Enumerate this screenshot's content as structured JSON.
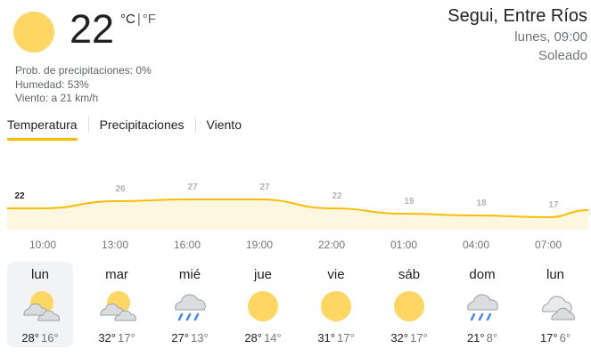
{
  "current": {
    "temp": "22",
    "unit_c": "°C",
    "unit_sep": "|",
    "unit_f": "°F",
    "precip": "Prob. de precipitaciones: 0%",
    "humidity": "Humedad: 53%",
    "wind": "Viento: a 21 km/h",
    "icon": "sun-icon"
  },
  "location": {
    "name": "Segui, Entre Ríos",
    "time": "lunes, 09:00",
    "condition": "Soleado"
  },
  "tabs": [
    {
      "label": "Temperatura",
      "active": true
    },
    {
      "label": "Precipitaciones",
      "active": false
    },
    {
      "label": "Viento",
      "active": false
    }
  ],
  "chart_data": {
    "type": "area",
    "x": [
      "10:00",
      "13:00",
      "16:00",
      "19:00",
      "22:00",
      "01:00",
      "04:00",
      "07:00"
    ],
    "values": [
      22,
      26,
      27,
      27,
      22,
      19,
      18,
      17
    ],
    "labels": [
      "22",
      "26",
      "27",
      "27",
      "22",
      "19",
      "18",
      "17"
    ],
    "color": "#fbbc04",
    "fill": "#fef7e0"
  },
  "days": [
    {
      "name": "lun",
      "icon": "partly-cloudy-icon",
      "hi": "28°",
      "lo": "16°",
      "selected": true
    },
    {
      "name": "mar",
      "icon": "partly-cloudy-icon",
      "hi": "32°",
      "lo": "17°",
      "selected": false
    },
    {
      "name": "mié",
      "icon": "rain-icon",
      "hi": "27°",
      "lo": "13°",
      "selected": false
    },
    {
      "name": "jue",
      "icon": "sun-icon",
      "hi": "28°",
      "lo": "14°",
      "selected": false
    },
    {
      "name": "vie",
      "icon": "sun-icon",
      "hi": "31°",
      "lo": "17°",
      "selected": false
    },
    {
      "name": "sáb",
      "icon": "sun-icon",
      "hi": "32°",
      "lo": "17°",
      "selected": false
    },
    {
      "name": "dom",
      "icon": "rain-icon",
      "hi": "21°",
      "lo": "8°",
      "selected": false
    },
    {
      "name": "lun",
      "icon": "cloudy-icon",
      "hi": "17°",
      "lo": "6°",
      "selected": false
    }
  ]
}
